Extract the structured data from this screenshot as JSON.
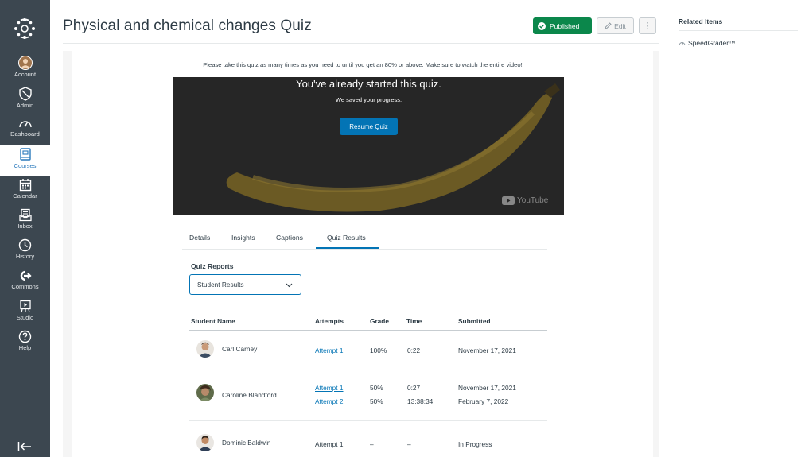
{
  "nav": {
    "account": "Account",
    "admin": "Admin",
    "dashboard": "Dashboard",
    "courses": "Courses",
    "calendar": "Calendar",
    "inbox": "Inbox",
    "history": "History",
    "commons": "Commons",
    "studio": "Studio",
    "help": "Help"
  },
  "header": {
    "title": "Physical and chemical changes Quiz",
    "published_label": "Published",
    "edit_label": "Edit",
    "kebab": "⋮"
  },
  "related": {
    "title": "Related Items",
    "speedgrader": "SpeedGrader™"
  },
  "notice": "Please take this quiz as many times as you need to until you get an 80% or above. Make sure to watch the entire video!",
  "video": {
    "title": "You've already started this quiz.",
    "subtitle": "We saved your progress.",
    "resume_label": "Resume Quiz",
    "youtube_label": "YouTube"
  },
  "tabs": [
    "Details",
    "Insights",
    "Captions",
    "Quiz Results"
  ],
  "reports": {
    "label": "Quiz Reports",
    "selected": "Student Results"
  },
  "table": {
    "headers": [
      "Student Name",
      "Attempts",
      "Grade",
      "Time",
      "Submitted"
    ],
    "rows": [
      {
        "name": "Carl Carney",
        "attempts": [
          "Attempt 1"
        ],
        "grades": [
          "100%"
        ],
        "times": [
          "0:22"
        ],
        "submitted": [
          "November 17, 2021"
        ]
      },
      {
        "name": "Caroline Blandford",
        "attempts": [
          "Attempt 1",
          "Attempt 2"
        ],
        "grades": [
          "50%",
          "50%"
        ],
        "times": [
          "0:27",
          "13:38:34"
        ],
        "submitted": [
          "November 17, 2021",
          "February 7, 2022"
        ]
      },
      {
        "name": "Dominic Baldwin",
        "attempts": [
          "Attempt 1"
        ],
        "grades": [
          "–"
        ],
        "times": [
          "–"
        ],
        "submitted": [
          "In Progress"
        ]
      }
    ]
  },
  "colors": {
    "nav_bg": "#3c4750",
    "published_green": "#0b874b",
    "brand_blue": "#0374b5"
  }
}
